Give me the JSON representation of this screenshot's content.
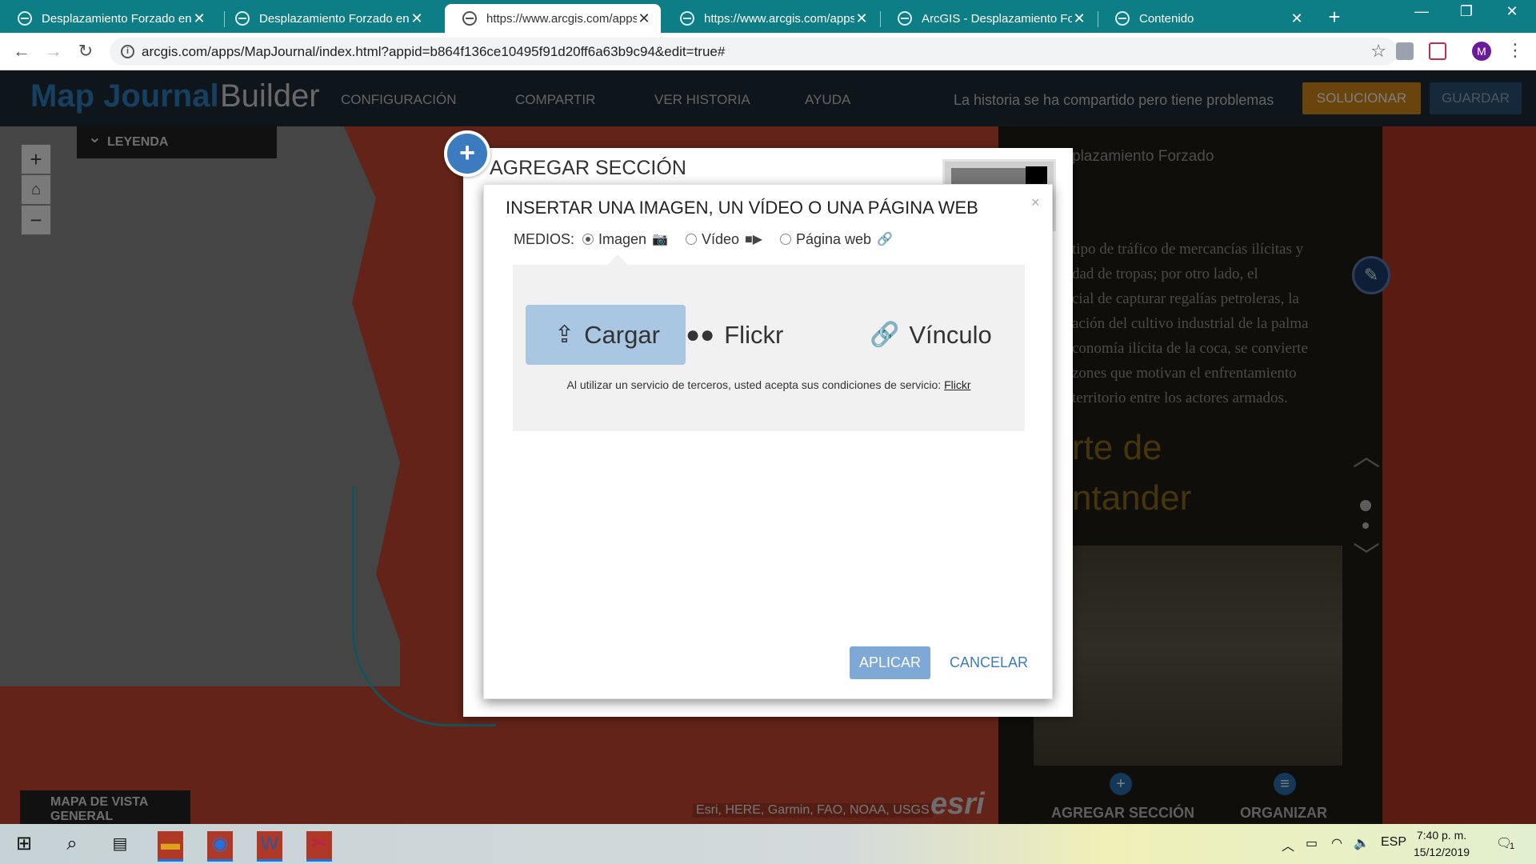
{
  "browser": {
    "tabs": [
      {
        "title": "Desplazamiento Forzado en Colombia",
        "active": false
      },
      {
        "title": "Desplazamiento Forzado en Colombia",
        "active": false
      },
      {
        "title": "https://www.arcgis.com/apps/MapJournal",
        "active": true
      },
      {
        "title": "https://www.arcgis.com/apps/MapJournal",
        "active": false
      },
      {
        "title": "ArcGIS - Desplazamiento Forzado",
        "active": false
      },
      {
        "title": "Contenido",
        "active": false
      }
    ],
    "new_tab": "+",
    "url": "arcgis.com/apps/MapJournal/index.html?appid=b864f136ce10495f91d20ff6a63b9c94&edit=true#",
    "avatar_letter": "M"
  },
  "app": {
    "logo_main": "Map Journal",
    "logo_sub": "Builder",
    "menu": [
      "CONFIGURACIÓN",
      "COMPARTIR",
      "VER HISTORIA",
      "AYUDA"
    ],
    "share_message": "La historia se ha compartido pero tiene problemas",
    "fix_button": "SOLUCIONAR",
    "save_button": "GUARDAR",
    "legend": "LEYENDA",
    "overview_map": "MAPA DE VISTA GENERAL",
    "attribution": "Esri, HERE, Garmin, FAO, NOAA, USGS",
    "esri_logo": "esri",
    "side_title": "plazamiento Forzado",
    "side_text": [
      "tipo de tráfico de mercancías ilícitas y",
      "dad de tropas; por otro lado, el",
      "cial de capturar regalías petroleras, la",
      "ación del cultivo industrial de la palma",
      "conomía ilícita de la coca, se convierte",
      "zones que motivan el enfrentamiento",
      "territorio entre los actores armados."
    ],
    "side_heading_1": "rte de",
    "side_heading_2": "ntander",
    "footer_add": "AGREGAR SECCIÓN",
    "footer_organize": "ORGANIZAR"
  },
  "outer_dialog": {
    "title": "AGREGAR SECCIÓN"
  },
  "media_dialog": {
    "title": "INSERTAR UNA IMAGEN, UN VÍDEO O UNA PÁGINA WEB",
    "close": "×",
    "media_label": "MEDIOS:",
    "options": [
      {
        "label": "Imagen",
        "icon": "camera-icon",
        "selected": true
      },
      {
        "label": "Vídeo",
        "icon": "video-camera-icon",
        "selected": false
      },
      {
        "label": "Página web",
        "icon": "link-icon",
        "selected": false
      }
    ],
    "sources": [
      {
        "label": "Cargar",
        "icon": "upload-icon",
        "selected": true
      },
      {
        "label": "Flickr",
        "icon": "flickr-icon",
        "selected": false
      },
      {
        "label": "Vínculo",
        "icon": "link-icon",
        "selected": false
      }
    ],
    "terms_text": "Al utilizar un servicio de terceros, usted acepta sus condiciones de servicio:",
    "terms_link": "Flickr",
    "apply_button": "APLICAR",
    "cancel_button": "CANCELAR"
  },
  "taskbar": {
    "language": "ESP",
    "time": "7:40 p. m.",
    "date": "15/12/2019",
    "notifications": "1"
  },
  "colors": {
    "tab_strip": "#0e7e86",
    "app_header": "#1d2a37",
    "accent_blue": "#3c7bbf",
    "apply_button": "#7ea8d6",
    "selected_source": "#a9c6e3",
    "fix_button": "#d28a1b"
  }
}
